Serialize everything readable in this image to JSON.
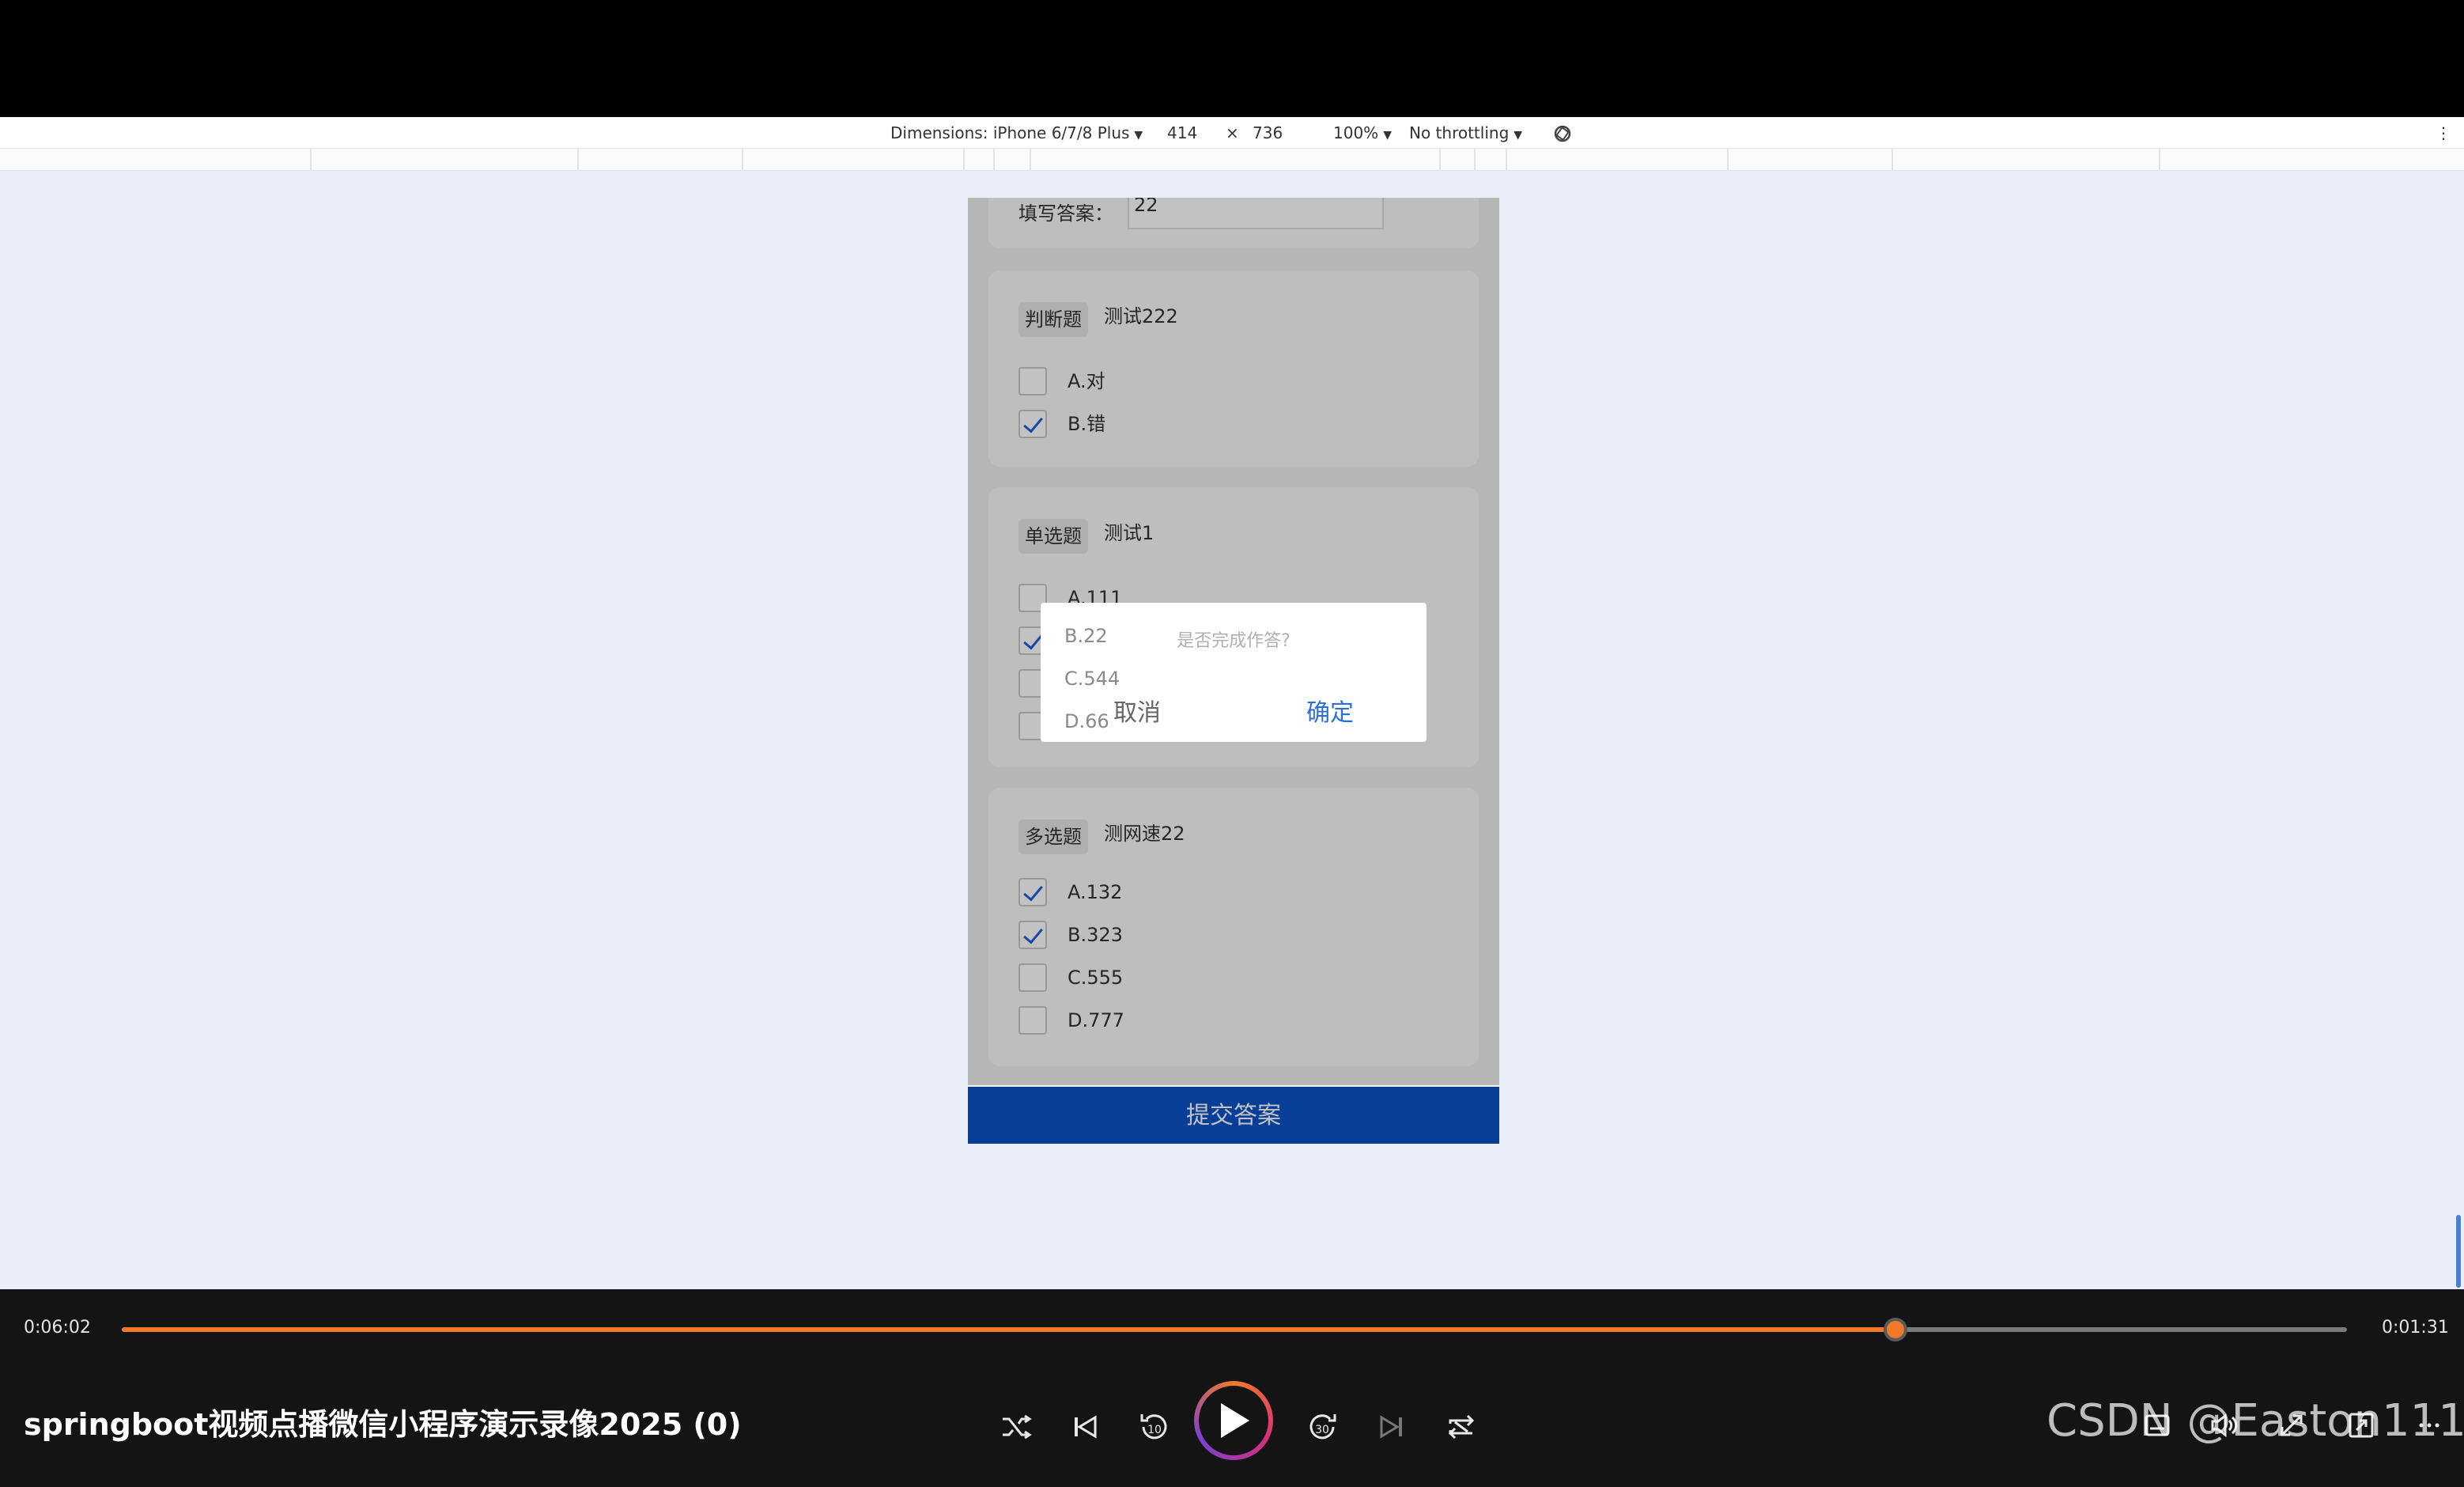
{
  "devtools": {
    "dimensions_label": "Dimensions: iPhone 6/7/8 Plus",
    "width": "414",
    "times": "×",
    "height": "736",
    "zoom": "100%",
    "throttling": "No throttling"
  },
  "page": {
    "fill_label": "填写答案：",
    "fill_value": "22",
    "questions": [
      {
        "tag": "判断题",
        "title": "测试222",
        "options": [
          {
            "label": "A.对",
            "checked": false
          },
          {
            "label": "B.错",
            "checked": true
          }
        ]
      },
      {
        "tag": "单选题",
        "title": "测试1",
        "options": [
          {
            "label": "A.111",
            "checked": false
          },
          {
            "label": "B.22",
            "checked": true
          },
          {
            "label": "C.544",
            "checked": false
          },
          {
            "label": "D.66",
            "checked": false
          }
        ]
      },
      {
        "tag": "多选题",
        "title": "测网速22",
        "options": [
          {
            "label": "A.132",
            "checked": true
          },
          {
            "label": "B.323",
            "checked": true
          },
          {
            "label": "C.555",
            "checked": false
          },
          {
            "label": "D.777",
            "checked": false
          }
        ]
      }
    ],
    "submit_label": "提交答案"
  },
  "dialog": {
    "message": "是否完成作答?",
    "cancel_label": "取消",
    "confirm_label": "确定"
  },
  "player": {
    "elapsed": "0:06:02",
    "remaining": "0:01:31",
    "progress": 0.797,
    "title": "springboot视频点播微信小程序演示录像2025 (0)",
    "accent_color": "#f07a2a",
    "controls": [
      "shuffle-icon",
      "previous-icon",
      "rewind-10-icon",
      "play-icon",
      "forward-30-icon",
      "next-icon",
      "repeat-icon"
    ],
    "right_controls": [
      "subtitles-icon",
      "volume-icon",
      "fullscreen-icon",
      "miniplayer-icon",
      "more-icon"
    ]
  },
  "watermark": "CSDN @Easton111"
}
